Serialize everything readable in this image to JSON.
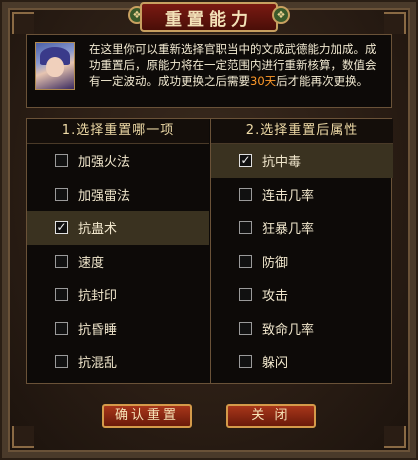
{
  "window": {
    "title": "重置能力"
  },
  "info": {
    "text_main": "在这里你可以重新选择官职当中的文成武德能力加成。成功重置后，原能力将在一定范围内进行重新核算，数值会有一定波动。成功更换之后需要",
    "text_highlight": "30天",
    "text_tail": "后才能再次更换。"
  },
  "left_column": {
    "header": "1.选择重置哪一项",
    "items": [
      {
        "label": "加强火法",
        "checked": false
      },
      {
        "label": "加强雷法",
        "checked": false
      },
      {
        "label": "抗蛊术",
        "checked": true
      },
      {
        "label": "速度",
        "checked": false
      },
      {
        "label": "抗封印",
        "checked": false
      },
      {
        "label": "抗昏睡",
        "checked": false
      },
      {
        "label": "抗混乱",
        "checked": false
      }
    ]
  },
  "right_column": {
    "header": "2.选择重置后属性",
    "items": [
      {
        "label": "抗中毒",
        "checked": true
      },
      {
        "label": "连击几率",
        "checked": false
      },
      {
        "label": "狂暴几率",
        "checked": false
      },
      {
        "label": "防御",
        "checked": false
      },
      {
        "label": "攻击",
        "checked": false
      },
      {
        "label": "致命几率",
        "checked": false
      },
      {
        "label": "躲闪",
        "checked": false
      }
    ]
  },
  "buttons": {
    "confirm_label": "确认重置",
    "close_label": "关 闭"
  },
  "colors": {
    "highlight": "#ff9a2a",
    "title_bg": "#7a1a12",
    "button_bg": "#a8361a",
    "selected_row_bg": "#3a3220"
  },
  "icons": {
    "check": "✓",
    "ornament": "❖"
  }
}
